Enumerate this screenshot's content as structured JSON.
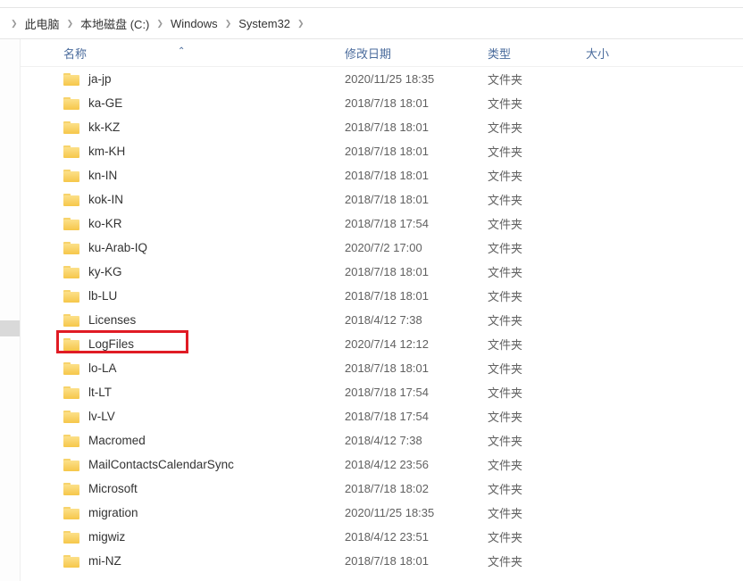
{
  "breadcrumb": {
    "items": [
      "此电脑",
      "本地磁盘 (C:)",
      "Windows",
      "System32"
    ]
  },
  "columns": {
    "name": "名称",
    "date": "修改日期",
    "type": "类型",
    "size": "大小"
  },
  "rows": [
    {
      "name": "ja-jp",
      "date": "2020/11/25 18:35",
      "type": "文件夹",
      "size": ""
    },
    {
      "name": "ka-GE",
      "date": "2018/7/18 18:01",
      "type": "文件夹",
      "size": ""
    },
    {
      "name": "kk-KZ",
      "date": "2018/7/18 18:01",
      "type": "文件夹",
      "size": ""
    },
    {
      "name": "km-KH",
      "date": "2018/7/18 18:01",
      "type": "文件夹",
      "size": ""
    },
    {
      "name": "kn-IN",
      "date": "2018/7/18 18:01",
      "type": "文件夹",
      "size": ""
    },
    {
      "name": "kok-IN",
      "date": "2018/7/18 18:01",
      "type": "文件夹",
      "size": ""
    },
    {
      "name": "ko-KR",
      "date": "2018/7/18 17:54",
      "type": "文件夹",
      "size": ""
    },
    {
      "name": "ku-Arab-IQ",
      "date": "2020/7/2 17:00",
      "type": "文件夹",
      "size": ""
    },
    {
      "name": "ky-KG",
      "date": "2018/7/18 18:01",
      "type": "文件夹",
      "size": ""
    },
    {
      "name": "lb-LU",
      "date": "2018/7/18 18:01",
      "type": "文件夹",
      "size": ""
    },
    {
      "name": "Licenses",
      "date": "2018/4/12 7:38",
      "type": "文件夹",
      "size": ""
    },
    {
      "name": "LogFiles",
      "date": "2020/7/14 12:12",
      "type": "文件夹",
      "size": ""
    },
    {
      "name": "lo-LA",
      "date": "2018/7/18 18:01",
      "type": "文件夹",
      "size": ""
    },
    {
      "name": "lt-LT",
      "date": "2018/7/18 17:54",
      "type": "文件夹",
      "size": ""
    },
    {
      "name": "lv-LV",
      "date": "2018/7/18 17:54",
      "type": "文件夹",
      "size": ""
    },
    {
      "name": "Macromed",
      "date": "2018/4/12 7:38",
      "type": "文件夹",
      "size": ""
    },
    {
      "name": "MailContactsCalendarSync",
      "date": "2018/4/12 23:56",
      "type": "文件夹",
      "size": ""
    },
    {
      "name": "Microsoft",
      "date": "2018/7/18 18:02",
      "type": "文件夹",
      "size": ""
    },
    {
      "name": "migration",
      "date": "2020/11/25 18:35",
      "type": "文件夹",
      "size": ""
    },
    {
      "name": "migwiz",
      "date": "2018/4/12 23:51",
      "type": "文件夹",
      "size": ""
    },
    {
      "name": "mi-NZ",
      "date": "2018/7/18 18:01",
      "type": "文件夹",
      "size": ""
    }
  ],
  "highlighted_row_index": 11
}
